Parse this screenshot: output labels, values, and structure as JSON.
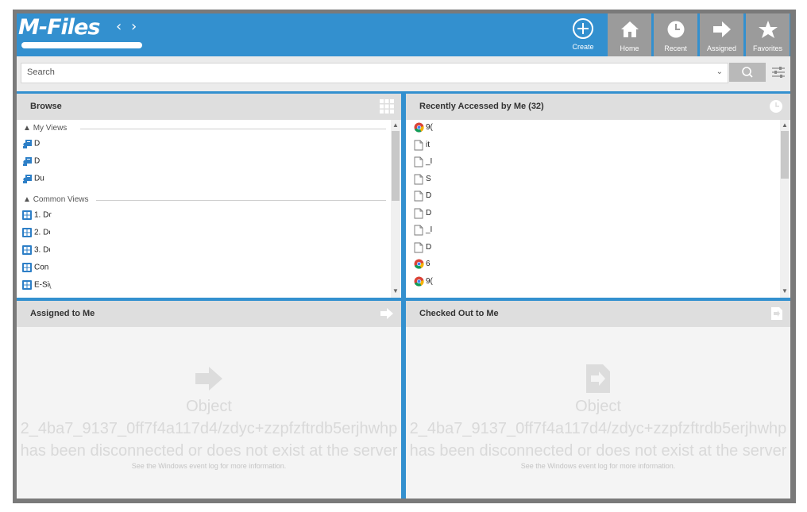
{
  "app": {
    "logo_text": "M-Files",
    "back_arrow": "‹",
    "forward_arrow": "›"
  },
  "topbar": {
    "create_label": "Create",
    "nav": [
      {
        "label": "Home",
        "icon": "home-icon"
      },
      {
        "label": "Recent",
        "icon": "clock-icon"
      },
      {
        "label": "Assigned",
        "icon": "arrow-right-icon"
      },
      {
        "label": "Favorites",
        "icon": "star-icon"
      }
    ]
  },
  "search": {
    "placeholder": "Search",
    "dropdown_glyph": "⌄"
  },
  "browse": {
    "title": "Browse",
    "groups": [
      {
        "label": "My Views",
        "items": [
          "D",
          "D",
          "Du"
        ]
      },
      {
        "label": "Common Views",
        "items": [
          "1. Do",
          "2. Do",
          "3. Do",
          "Con",
          "E-Sig"
        ]
      }
    ]
  },
  "recent": {
    "title": "Recently Accessed by Me (32)",
    "items": [
      {
        "text": "9(",
        "icon": "chrome-icon"
      },
      {
        "text": "it",
        "icon": "document-icon"
      },
      {
        "text": "_I",
        "icon": "document-icon"
      },
      {
        "text": "S",
        "icon": "document-icon"
      },
      {
        "text": "D",
        "icon": "document-icon"
      },
      {
        "text": "D",
        "icon": "document-icon"
      },
      {
        "text": "_I",
        "icon": "document-icon"
      },
      {
        "text": "D",
        "icon": "document-icon"
      },
      {
        "text": "6",
        "icon": "chrome-icon"
      },
      {
        "text": "9(",
        "icon": "chrome-icon"
      }
    ]
  },
  "assigned": {
    "title": "Assigned to Me",
    "error_object": "Object",
    "error_line1": "2_4ba7_9137_0ff7f4a117d4/zdyc+zzpfzftrdb5erjhwhp",
    "error_line2": "has been disconnected or does not exist at the server",
    "error_hint": "See the Windows event log for more information."
  },
  "checkedout": {
    "title": "Checked Out to Me",
    "error_object": "Object",
    "error_line1": "2_4ba7_9137_0ff7f4a117d4/zdyc+zzpfzftrdb5erjhwhp",
    "error_line2": "has been disconnected or does not exist at the server",
    "error_hint": "See the Windows event log for more information."
  },
  "colors": {
    "accent": "#3390cf",
    "nav_gray": "#9b9b9b",
    "header_gray": "#dedede"
  }
}
